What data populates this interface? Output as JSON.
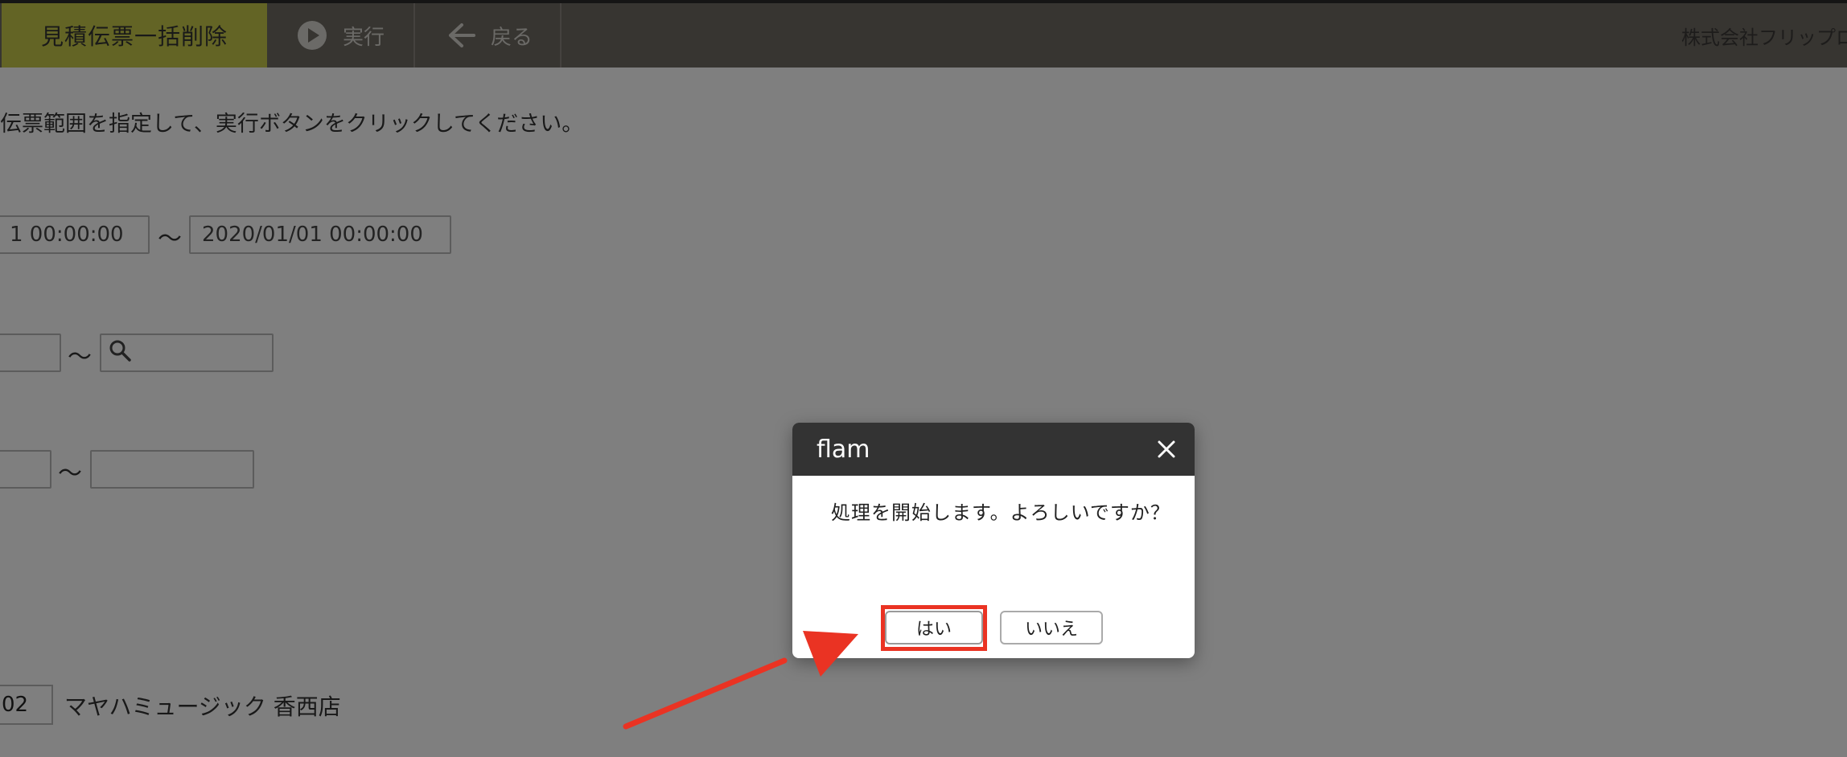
{
  "toolbar": {
    "title": "見積伝票一括削除",
    "run_label": "実行",
    "back_label": "戻る",
    "company": "株式会社フリップロ"
  },
  "page": {
    "instruction": "伝票範囲を指定して、実行ボタンをクリックしてください。",
    "date_from": "1 00:00:00",
    "date_to": "2020/01/01 00:00:00",
    "tilde": "〜",
    "store_code": "02",
    "store_name": "マヤハミュージック 香西店"
  },
  "dialog": {
    "title": "flam",
    "message": "処理を開始します。よろしいですか？",
    "yes_label": "はい",
    "no_label": "いいえ"
  },
  "colors": {
    "toolbar_bg": "#6f6a63",
    "title_bg": "#c6c94a",
    "dialog_header": "#333333",
    "highlight": "#ea3323"
  }
}
